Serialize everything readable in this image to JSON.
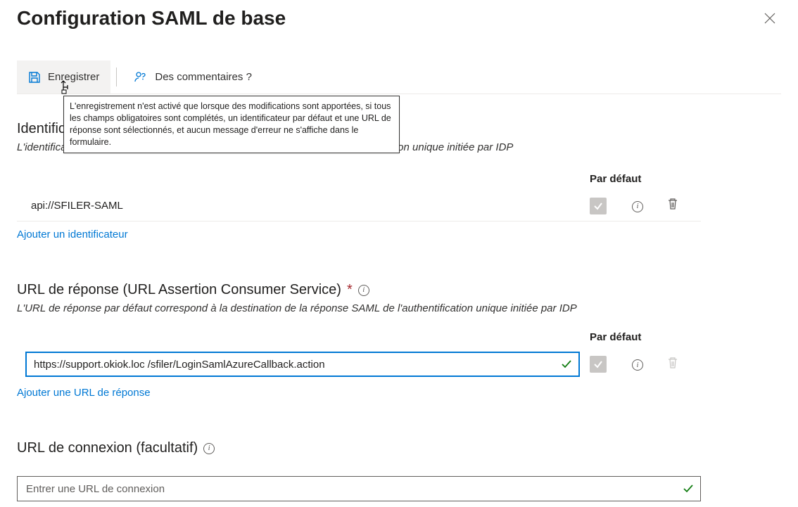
{
  "header": {
    "title": "Configuration SAML de base"
  },
  "toolbar": {
    "save_label": "Enregistrer",
    "feedback_label": "Des commentaires ?"
  },
  "tooltip": {
    "text": "L'enregistrement n'est activé que lorsque des modifications sont apportées, si tous les champs obligatoires sont complétés, un identificateur par défaut et une URL de réponse sont sélectionnés, et aucun message d'erreur ne s'affiche dans le formulaire."
  },
  "sections": {
    "identifier": {
      "title": "Identificateur (ID d'entité)",
      "required_mark": "*",
      "desc": "L'identificateur par défaut sera l'audience de la réponse SAML pour l'authentification unique initiée par IDP",
      "default_col": "Par défaut",
      "value": "api://SFILER-SAML",
      "add_link": "Ajouter un identificateur"
    },
    "reply": {
      "title": "URL de réponse (URL Assertion Consumer Service)",
      "required_mark": "*",
      "desc": "L'URL de réponse par défaut correspond à la destination de la réponse SAML de l'authentification unique initiée par IDP",
      "default_col": "Par défaut",
      "value": "https://support.okiok.loc /sfiler/LoginSamlAzureCallback.action",
      "add_link": "Ajouter une URL de réponse"
    },
    "signon": {
      "title": "URL de connexion (facultatif)",
      "placeholder": "Entrer une URL de connexion"
    }
  }
}
